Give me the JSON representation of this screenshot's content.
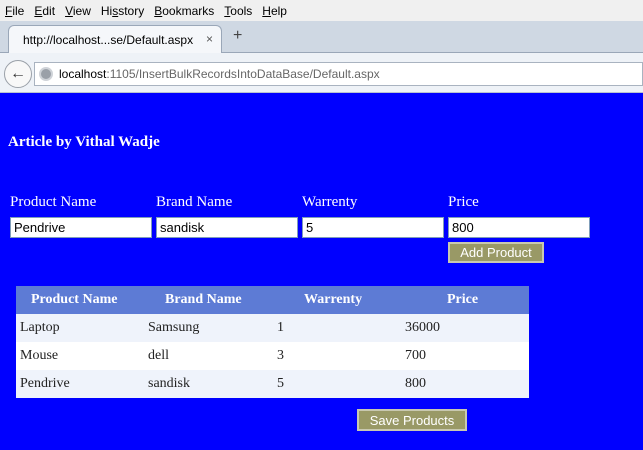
{
  "menu": [
    {
      "key": "F",
      "rest": "ile"
    },
    {
      "key": "E",
      "rest": "dit"
    },
    {
      "key": "V",
      "rest": "iew"
    },
    {
      "key": "",
      "pre": "Hi",
      "rest": "story",
      "underline": "s"
    },
    {
      "key": "B",
      "rest": "ookmarks"
    },
    {
      "key": "T",
      "rest": "ools"
    },
    {
      "key": "H",
      "rest": "elp"
    }
  ],
  "tab": {
    "title": "http://localhost...se/Default.aspx",
    "close": "×",
    "new": "+"
  },
  "address": {
    "host": "localhost",
    "path": ":1105/InsertBulkRecordsIntoDataBase/Default.aspx"
  },
  "page": {
    "title": "Article by Vithal Wadje",
    "form": {
      "product_label": "Product Name",
      "brand_label": "Brand Name",
      "warrenty_label": "Warrenty",
      "price_label": "Price",
      "product_value": "Pendrive",
      "brand_value": "sandisk",
      "warrenty_value": "5",
      "price_value": "800",
      "add_button": "Add Product"
    },
    "grid": {
      "headers": [
        "Product Name",
        "Brand Name",
        "Warrenty",
        "Price"
      ],
      "rows": [
        [
          "Laptop",
          "Samsung",
          "1",
          "36000"
        ],
        [
          "Mouse",
          "dell",
          "3",
          "700"
        ],
        [
          "Pendrive",
          "sandisk",
          "5",
          "800"
        ]
      ]
    },
    "save_button": "Save Products"
  }
}
